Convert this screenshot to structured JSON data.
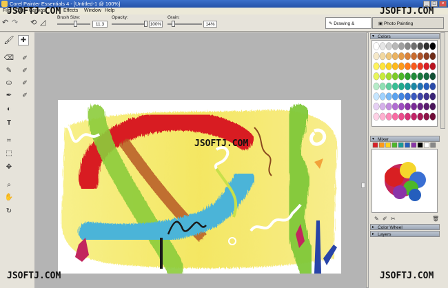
{
  "window": {
    "title": "Corel Painter Essentials 4 - [Untitled-1 @ 100%]",
    "buttons": [
      "_",
      "□",
      "×"
    ]
  },
  "menu": {
    "items": [
      "File",
      "Edit",
      "Canvas",
      "Effects",
      "Window",
      "Help"
    ]
  },
  "property_bar": {
    "brush_size_label": "Brush Size:",
    "brush_size_value": "11.3",
    "brush_size_level": 0.55,
    "opacity_label": "Opacity:",
    "opacity_value": "100%",
    "opacity_level": 1.0,
    "grain_label": "Grain:",
    "grain_value": "14%",
    "grain_level": 0.14
  },
  "mode_tabs": [
    {
      "label": "Drawing & Painting",
      "active": true,
      "icon": "brush-icon"
    },
    {
      "label": "Photo Painting",
      "active": false,
      "icon": "photo-icon"
    }
  ],
  "toolbox": {
    "tools": [
      "brush-icon",
      "eraser-icon",
      "dropper-icon",
      "paint-bucket-icon",
      "pen-icon",
      "dodge-icon",
      "text-icon",
      "crop-icon",
      "selection-icon",
      "transform-icon",
      "zoom-icon",
      "hand-icon",
      "rotate-icon"
    ]
  },
  "panels": {
    "colors": {
      "label": "Colors"
    },
    "mixer": {
      "label": "Mixer"
    },
    "color_wheel": {
      "label": "Color Wheel"
    },
    "layers": {
      "label": "Layers"
    }
  },
  "colors": {
    "palette": [
      [
        "#ffffff",
        "#e6e6e6",
        "#cfcfcf",
        "#b8b8b8",
        "#a0a0a0",
        "#888888",
        "#6e6e6e",
        "#505050",
        "#2e2e2e",
        "#000000"
      ],
      [
        "#f6e9c8",
        "#f2d8a0",
        "#f0c77a",
        "#eab260",
        "#e59a46",
        "#d9823a",
        "#c96b2e",
        "#b0542a",
        "#8e3f22",
        "#6e2c18"
      ],
      [
        "#fff35c",
        "#ffe53a",
        "#ffd21f",
        "#ffb81a",
        "#ff9a1a",
        "#ff7b1a",
        "#f95a1c",
        "#ec3a22",
        "#d91f26",
        "#b81420"
      ],
      [
        "#e8f55a",
        "#c9eb3c",
        "#a6dd2e",
        "#7ccb28",
        "#4db82a",
        "#2ea02e",
        "#1f8b3a",
        "#1a7a3e",
        "#166a40",
        "#114f34"
      ],
      [
        "#b6ecc8",
        "#8fe0b4",
        "#5fd0a0",
        "#36bf94",
        "#22aa8e",
        "#1a9a98",
        "#1a87a6",
        "#1f72b3",
        "#255ebd",
        "#2a4aa8"
      ],
      [
        "#c6e6ff",
        "#9fd2ff",
        "#79baf7",
        "#5aa2ef",
        "#4286e2",
        "#3a6fd3",
        "#3a58bf",
        "#3e45a8",
        "#3f3490",
        "#3a2576"
      ],
      [
        "#e6d0f4",
        "#d5b0ea",
        "#c48ee0",
        "#b16cd2",
        "#9d4cc0",
        "#8a34a8",
        "#7a2a96",
        "#6a2382",
        "#5a1c6e",
        "#4a165a"
      ],
      [
        "#ffd2e6",
        "#ffb0d0",
        "#ff8cba",
        "#f96aa2",
        "#ec4c8c",
        "#d83478",
        "#c22466",
        "#a81a56",
        "#8e1448",
        "#700e38"
      ]
    ]
  },
  "mixer": {
    "swatches": [
      "#d91f26",
      "#ff9a1a",
      "#ffd21f",
      "#4db82a",
      "#1a9a98",
      "#255ebd",
      "#8a34a8",
      "#000000",
      "#ffffff",
      "#888888"
    ]
  },
  "watermarks": [
    "JSOFTJ.COM",
    "JSOFTJ.COM",
    "JSOFTJ.COM",
    "JSOFTJ.COM",
    "JSOFTJ.COM"
  ]
}
